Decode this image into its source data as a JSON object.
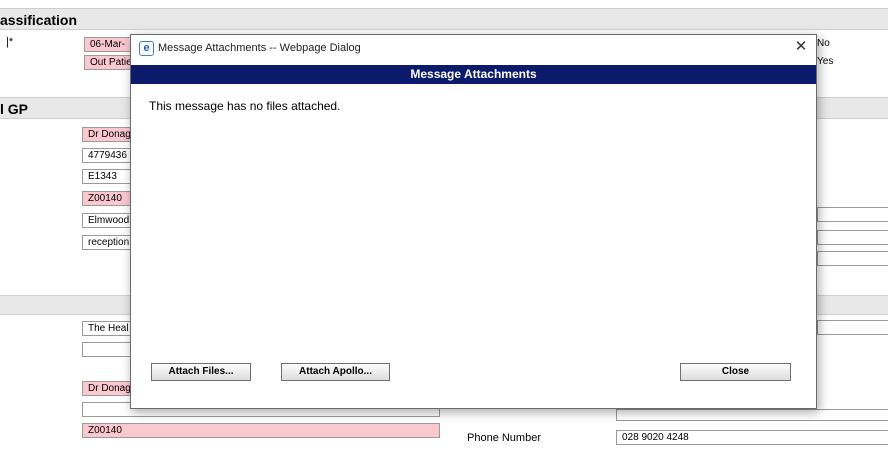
{
  "background": {
    "section_classification": "assification",
    "section_gp": "l GP",
    "row_marker": "|*",
    "fields": {
      "date": "06-Mar-",
      "patient_type": "Out Patie",
      "gp_name": "Dr Donag",
      "gp_number": "4779436",
      "gp_code": "E1343",
      "practice_code": "Z00140",
      "practice_name": "Elmwood",
      "email": "reception",
      "hospital": "The Heal",
      "blank_1": "",
      "consultant": "Dr Donag",
      "blank_2": "",
      "code_2": "Z00140"
    },
    "right_options": {
      "no": "No",
      "yes": "Yes"
    },
    "phone_label": "Phone Number",
    "phone_value": "028 9020 4248"
  },
  "dialog": {
    "window_title": "Message Attachments -- Webpage Dialog",
    "close_glyph": "✕",
    "header": "Message Attachments",
    "message": "This message has no files attached.",
    "buttons": {
      "attach_files": "Attach Files...",
      "attach_apollo": "Attach Apollo...",
      "close": "Close"
    }
  }
}
